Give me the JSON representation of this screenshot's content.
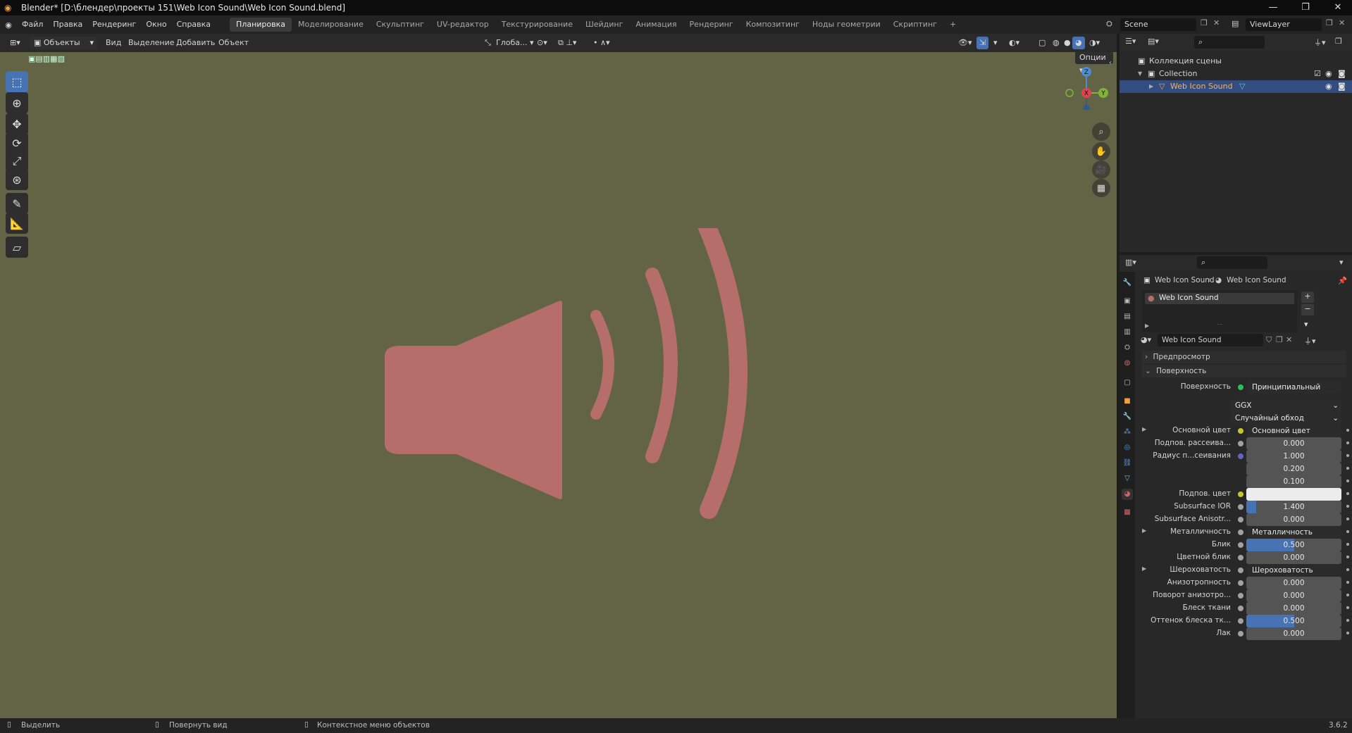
{
  "app": {
    "title": "Blender* [D:\\блендер\\проекты 151\\Web Icon Sound\\Web Icon Sound.blend]"
  },
  "menu": [
    "Файл",
    "Правка",
    "Рендеринг",
    "Окно",
    "Справка"
  ],
  "workspaces": [
    "Планировка",
    "Моделирование",
    "Скульптинг",
    "UV-редактор",
    "Текстурирование",
    "Шейдинг",
    "Анимация",
    "Рендеринг",
    "Композитинг",
    "Ноды геометрии",
    "Скриптинг"
  ],
  "active_workspace": "Планировка",
  "scene": {
    "name": "Scene",
    "view_layer": "ViewLayer"
  },
  "viewport_header": {
    "mode": "Объекты",
    "menus": [
      "Вид",
      "Выделение",
      "Добавить",
      "Объект"
    ],
    "orientation": "Глоба...",
    "options": "Опции"
  },
  "viewport": {
    "background": "#636445",
    "object_color": "#b56e6a"
  },
  "gizmo_axes": {
    "z": "Z",
    "x": "X",
    "y": "Y"
  },
  "outliner": {
    "root": "Коллекция сцены",
    "collection": "Collection",
    "object": "Web Icon Sound"
  },
  "properties": {
    "breadcrumb_object": "Web Icon Sound",
    "breadcrumb_material": "Web Icon Sound",
    "slot_material": "Web Icon Sound",
    "material_field": "Web Icon Sound",
    "panels": {
      "preview": "Предпросмотр",
      "surface": "Поверхность"
    },
    "surface_label": "Поверхность",
    "surface_value": "Принципиальный BSDF",
    "distribution": "GGX",
    "subsurface_method": "Случайный обход",
    "rows": [
      {
        "label": "Основной цвет",
        "value": "Основной цвет",
        "kind": "link",
        "dot": "g",
        "expand": true
      },
      {
        "label": "Подпов. рассеива...",
        "value": "0.000",
        "kind": "num",
        "dot": "k"
      },
      {
        "label": "Радиус п...сеивания",
        "value": "1.000",
        "kind": "num",
        "dot": "b"
      },
      {
        "label": "",
        "value": "0.200",
        "kind": "num",
        "dot": ""
      },
      {
        "label": "",
        "value": "0.100",
        "kind": "num",
        "dot": ""
      },
      {
        "label": "Подпов. цвет",
        "value": "",
        "kind": "white",
        "dot": "g"
      },
      {
        "label": "Subsurface IOR",
        "value": "1.400",
        "kind": "num",
        "dot": "k",
        "fill": 0.1
      },
      {
        "label": "Subsurface Anisotr...",
        "value": "0.000",
        "kind": "num",
        "dot": "k"
      },
      {
        "label": "Металличность",
        "value": "Металличность",
        "kind": "link",
        "dot": "k",
        "expand": true
      },
      {
        "label": "Блик",
        "value": "0.500",
        "kind": "num",
        "dot": "k",
        "fill": 0.5
      },
      {
        "label": "Цветной блик",
        "value": "0.000",
        "kind": "num",
        "dot": "k"
      },
      {
        "label": "Шероховатость",
        "value": "Шероховатость",
        "kind": "link",
        "dot": "k",
        "expand": true
      },
      {
        "label": "Анизотропность",
        "value": "0.000",
        "kind": "num",
        "dot": "k"
      },
      {
        "label": "Поворот анизотро...",
        "value": "0.000",
        "kind": "num",
        "dot": "k"
      },
      {
        "label": "Блеск ткани",
        "value": "0.000",
        "kind": "num",
        "dot": "k"
      },
      {
        "label": "Оттенок блеска тк...",
        "value": "0.500",
        "kind": "num",
        "dot": "k",
        "fill": 0.5
      },
      {
        "label": "Лак",
        "value": "0.000",
        "kind": "num",
        "dot": "k"
      }
    ]
  },
  "status": {
    "select": "Выделить",
    "rotate": "Повернуть вид",
    "context": "Контекстное меню объектов",
    "version": "3.6.2"
  }
}
